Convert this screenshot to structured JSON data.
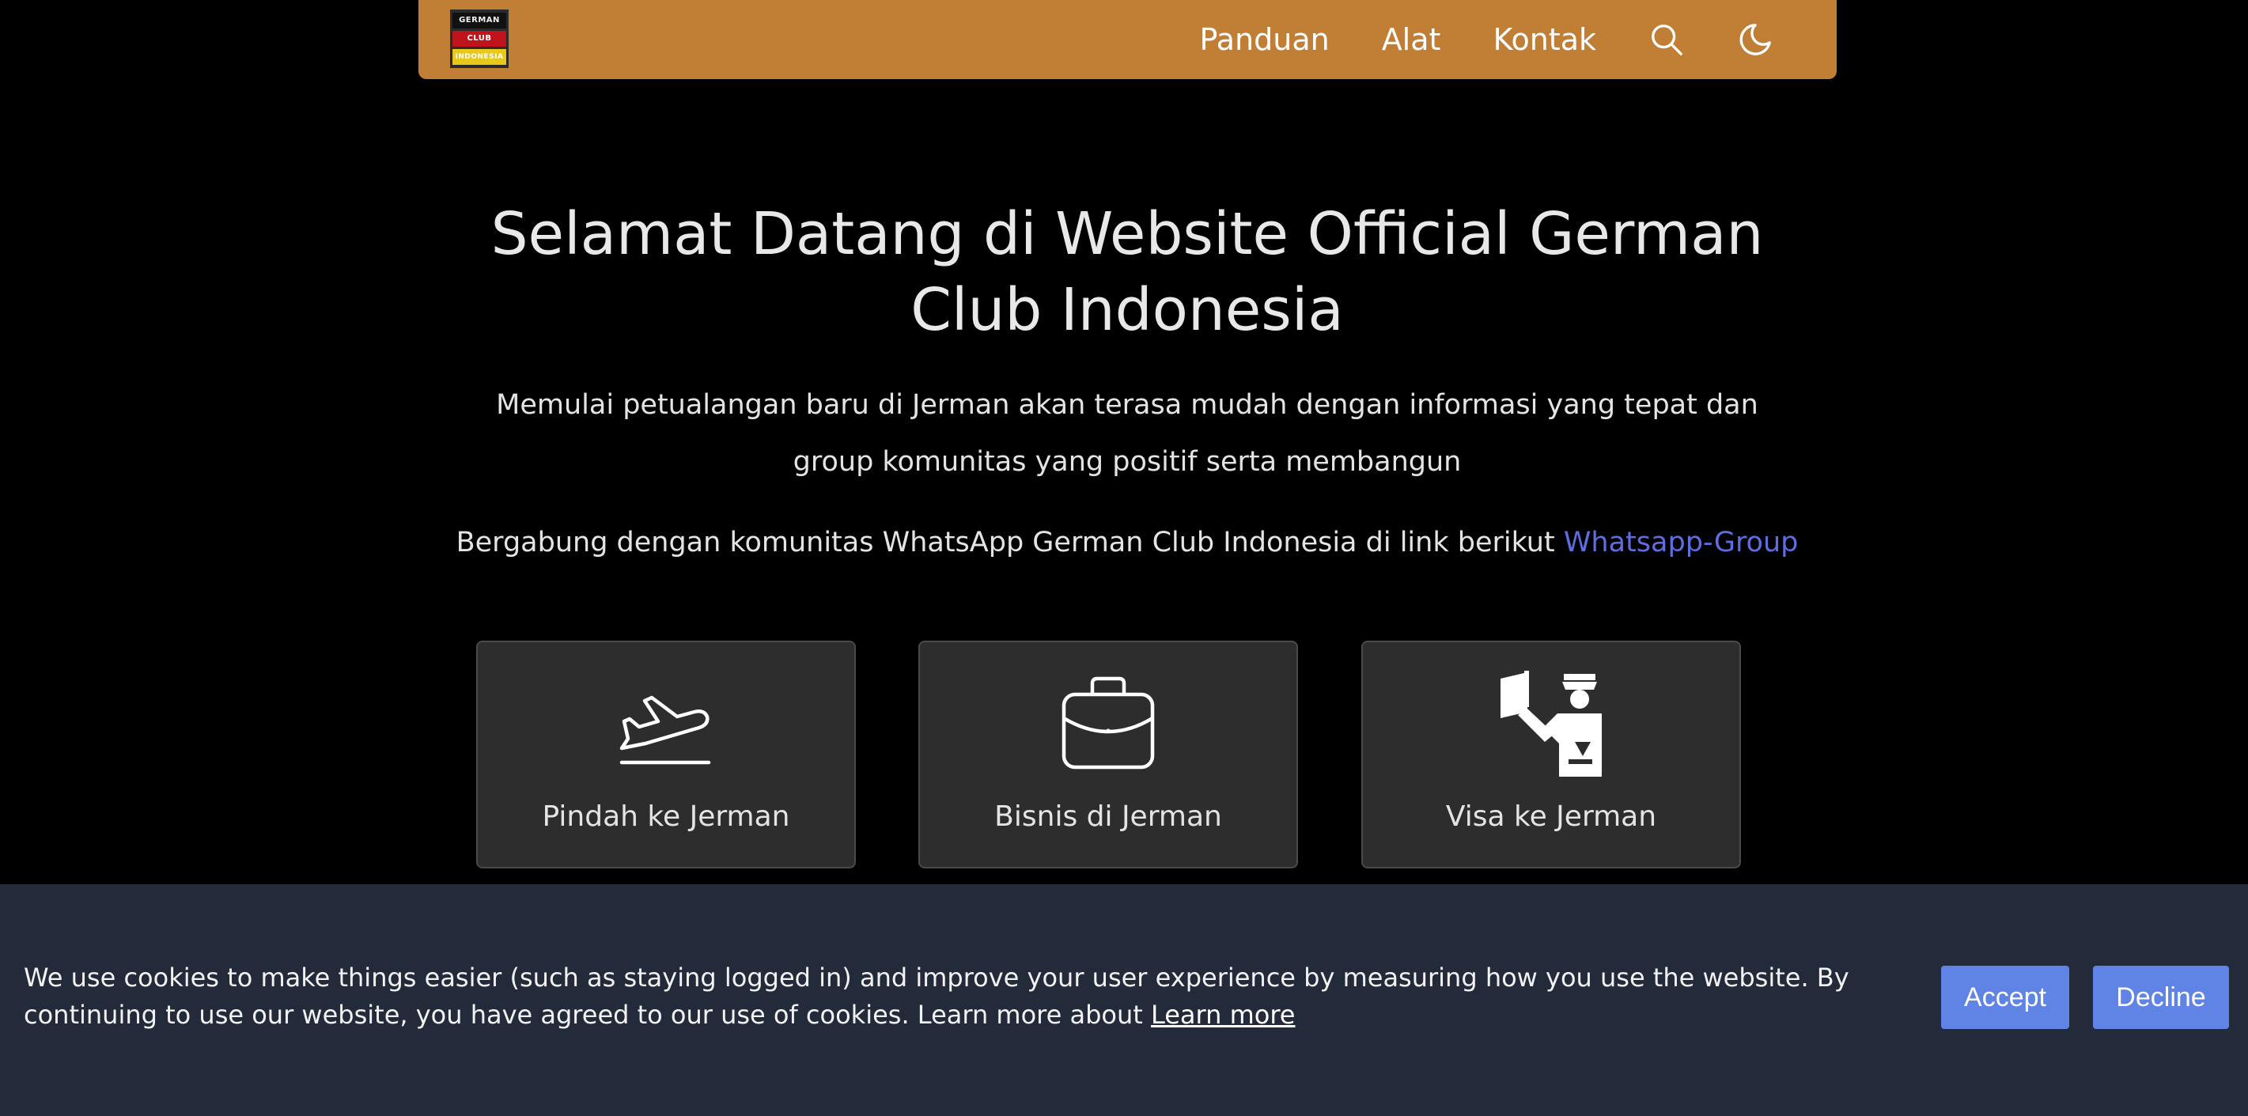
{
  "colors": {
    "header_accent": "#c17f35",
    "link": "#5f6de0",
    "cookie_bar": "#232a3a",
    "cookie_button": "#5f84e6",
    "card_bg": "#2d2d2d"
  },
  "header": {
    "logo": {
      "line1": "GERMAN",
      "line2": "CLUB",
      "line3": "INDONESIA"
    },
    "nav": [
      {
        "label": "Panduan"
      },
      {
        "label": "Alat"
      },
      {
        "label": "Kontak"
      }
    ],
    "icons": [
      "search-icon",
      "dark-mode-moon-icon"
    ]
  },
  "hero": {
    "title": "Selamat Datang di Website Official German Club Indonesia",
    "subtitle": "Memulai petualangan baru di Jerman akan terasa mudah dengan informasi yang tepat dan group komunitas yang positif serta membangun",
    "join_text": "Bergabung dengan komunitas WhatsApp German Club Indonesia di link berikut ",
    "join_link": "Whatsapp-Group"
  },
  "cards": [
    {
      "label": "Pindah ke Jerman",
      "icon": "airplane-takeoff-icon"
    },
    {
      "label": "Bisnis di Jerman",
      "icon": "briefcase-icon"
    },
    {
      "label": "Visa ke Jerman",
      "icon": "immigration-officer-icon"
    }
  ],
  "cookie": {
    "text": "We use cookies to make things easier (such as staying logged in) and improve your user experience by measuring how you use the website. By continuing to use our website, you have agreed to our use of cookies. Learn more about ",
    "link": "Learn more",
    "accept": "Accept",
    "decline": "Decline"
  }
}
